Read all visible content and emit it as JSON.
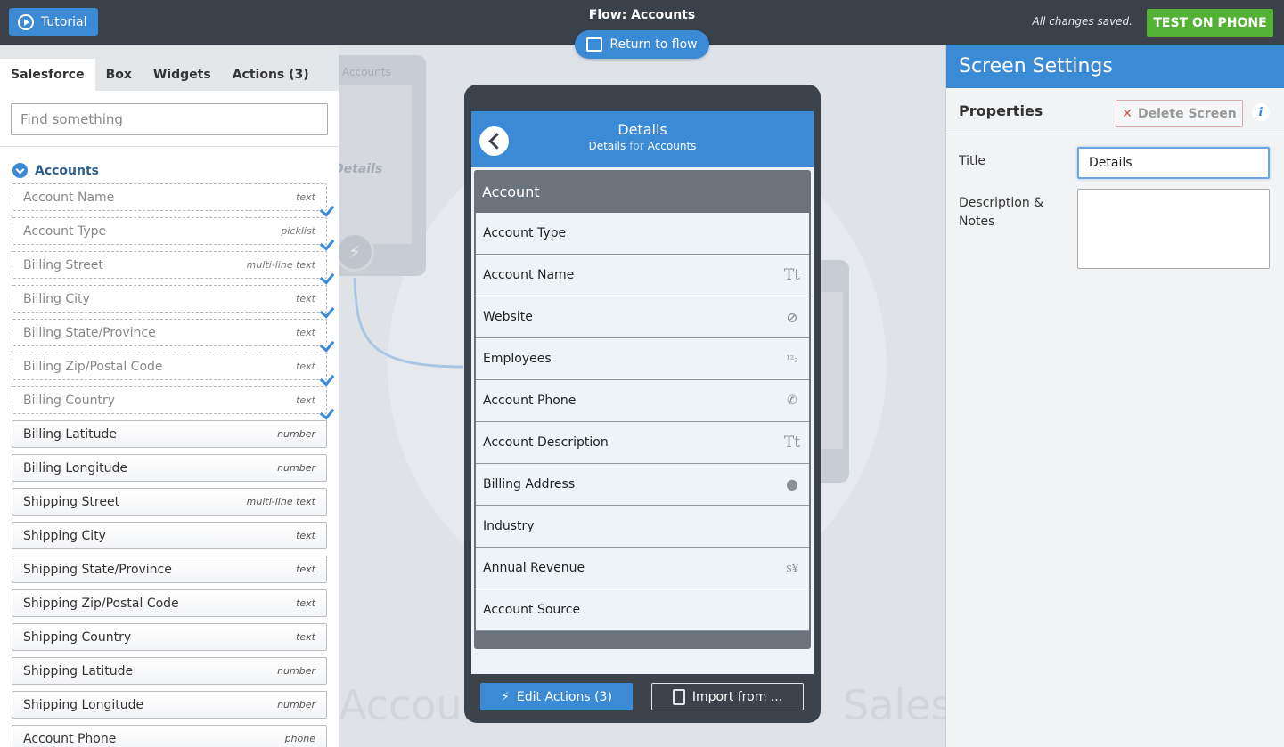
{
  "topbar": {
    "tutorial_label": "Tutorial",
    "flow_title": "Flow: Accounts",
    "save_status": "All changes saved.",
    "test_label": "TEST ON PHONE",
    "return_label": "Return to flow"
  },
  "left_panel": {
    "tabs": [
      {
        "label": "Salesforce",
        "active": true
      },
      {
        "label": "Box",
        "active": false
      },
      {
        "label": "Widgets",
        "active": false
      },
      {
        "label": "Actions (3)",
        "active": false
      }
    ],
    "search_placeholder": "Find something",
    "group_label": "Accounts",
    "fields": [
      {
        "name": "Account Name",
        "type": "text",
        "used": true
      },
      {
        "name": "Account Type",
        "type": "picklist",
        "used": true
      },
      {
        "name": "Billing Street",
        "type": "multi-line text",
        "used": true
      },
      {
        "name": "Billing City",
        "type": "text",
        "used": true
      },
      {
        "name": "Billing State/Province",
        "type": "text",
        "used": true
      },
      {
        "name": "Billing Zip/Postal Code",
        "type": "text",
        "used": true
      },
      {
        "name": "Billing Country",
        "type": "text",
        "used": true
      },
      {
        "name": "Billing Latitude",
        "type": "number",
        "used": false
      },
      {
        "name": "Billing Longitude",
        "type": "number",
        "used": false
      },
      {
        "name": "Shipping Street",
        "type": "multi-line text",
        "used": false
      },
      {
        "name": "Shipping City",
        "type": "text",
        "used": false
      },
      {
        "name": "Shipping State/Province",
        "type": "text",
        "used": false
      },
      {
        "name": "Shipping Zip/Postal Code",
        "type": "text",
        "used": false
      },
      {
        "name": "Shipping Country",
        "type": "text",
        "used": false
      },
      {
        "name": "Shipping Latitude",
        "type": "number",
        "used": false
      },
      {
        "name": "Shipping Longitude",
        "type": "number",
        "used": false
      },
      {
        "name": "Account Phone",
        "type": "phone",
        "used": false
      }
    ]
  },
  "canvas": {
    "ghost_left_label": "Accounts",
    "ghost_left_edit": "Details",
    "bg_word_left": "Accoun",
    "bg_word_right": "Sales"
  },
  "phone": {
    "title": "Details",
    "subtitle_left": "Details",
    "subtitle_for": "for",
    "subtitle_right": "Accounts",
    "card_title": "Account",
    "rows": [
      {
        "label": "Account Type",
        "icon": "none"
      },
      {
        "label": "Account Name",
        "icon": "text-icon",
        "glyph": "Tt"
      },
      {
        "label": "Website",
        "icon": "compass-icon",
        "glyph": "⊘"
      },
      {
        "label": "Employees",
        "icon": "number-icon",
        "glyph": "¹²₃"
      },
      {
        "label": "Account Phone",
        "icon": "phone-icon",
        "glyph": "✆"
      },
      {
        "label": "Account Description",
        "icon": "text-icon",
        "glyph": "Tt"
      },
      {
        "label": "Billing Address",
        "icon": "location-pin-icon",
        "glyph": "⬤"
      },
      {
        "label": "Industry",
        "icon": "none"
      },
      {
        "label": "Annual Revenue",
        "icon": "currency-icon",
        "glyph": "$¥"
      },
      {
        "label": "Account Source",
        "icon": "none"
      }
    ],
    "edit_actions_label": "Edit Actions (3)",
    "import_label": "Import from ..."
  },
  "right_panel": {
    "header": "Screen Settings",
    "properties_label": "Properties",
    "delete_label": "Delete Screen",
    "info_glyph": "i",
    "title_label": "Title",
    "title_value": "Details",
    "description_label_1": "Description &",
    "description_label_2": "Notes",
    "description_value": ""
  },
  "colors": {
    "accent": "#3a8ad6",
    "topbar": "#3b4149",
    "test_button": "#53b133",
    "phone_body": "#3d434a",
    "card": "#6b737c"
  }
}
